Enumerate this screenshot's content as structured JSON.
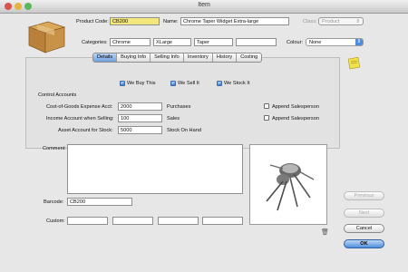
{
  "window": {
    "title": "Item"
  },
  "header": {
    "product_code_label": "Product Code:",
    "product_code_value": "CB200",
    "name_label": "Name:",
    "name_value": "Chrome Taper Widget Extra-large",
    "class_label": "Class:",
    "class_value": "Product",
    "categories_label": "Categories:",
    "categories": [
      "Chrome",
      "XLarge",
      "Taper",
      ""
    ],
    "colour_label": "Colour:",
    "colour_value": "None"
  },
  "tabs": [
    {
      "label": "Details",
      "selected": true
    },
    {
      "label": "Buying Info",
      "selected": false
    },
    {
      "label": "Selling Info",
      "selected": false
    },
    {
      "label": "Inventory",
      "selected": false
    },
    {
      "label": "History",
      "selected": false
    },
    {
      "label": "Costing",
      "selected": false
    }
  ],
  "details": {
    "checks": [
      {
        "label": "We Buy This",
        "checked": true
      },
      {
        "label": "We Sell It",
        "checked": true
      },
      {
        "label": "We Stock It",
        "checked": true
      }
    ],
    "control_accounts_label": "Control Accounts",
    "rows": [
      {
        "label": "Cost-of-Goods Expense Acct:",
        "value": "2000",
        "desc": "Purchases",
        "append_label": "Append Salesperson"
      },
      {
        "label": "Income Account when Selling:",
        "value": "100",
        "desc": "Sales",
        "append_label": "Append Salesperson"
      },
      {
        "label": "Asset Account for Stock:",
        "value": "5000",
        "desc": "Stock On Hand"
      }
    ]
  },
  "comment_label": "Comment:",
  "barcode_label": "Barcode:",
  "barcode_value": "CB200",
  "custom_label": "Custom:",
  "buttons": {
    "previous": "Previous",
    "next": "Next",
    "cancel": "Cancel",
    "ok": "OK"
  }
}
